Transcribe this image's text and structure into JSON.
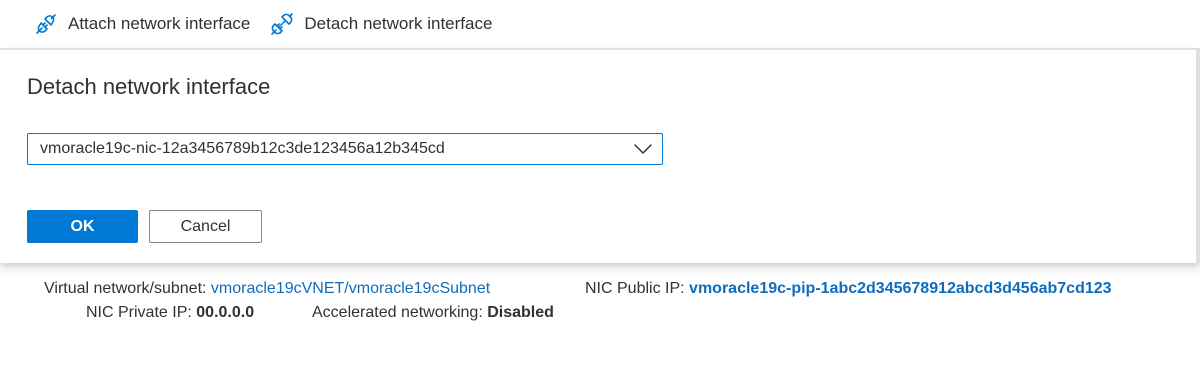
{
  "toolbar": {
    "attach_label": "Attach network interface",
    "detach_label": "Detach network interface"
  },
  "panel": {
    "title": "Detach network interface",
    "dropdown_value": "vmoracle19c-nic-12a3456789b12c3de123456a12b345cd",
    "ok_label": "OK",
    "cancel_label": "Cancel"
  },
  "details": {
    "vnet_label": "Virtual network/subnet:",
    "vnet_value": "vmoracle19cVNET/vmoracle19cSubnet",
    "public_ip_label": "NIC Public IP:",
    "public_ip_value": "vmoracle19c-pip-1abc2d345678912abcd3d456ab7cd123",
    "private_ip_label": "NIC Private IP:",
    "private_ip_value": "00.0.0.0",
    "accel_label": "Accelerated networking:",
    "accel_value": "Disabled"
  },
  "colors": {
    "accent": "#0078d4",
    "link": "#0f6cbd",
    "text": "#323130"
  },
  "icons": {
    "attach": "plug-connect-icon",
    "detach": "plug-disconnect-icon",
    "dropdown": "chevron-down-icon"
  }
}
